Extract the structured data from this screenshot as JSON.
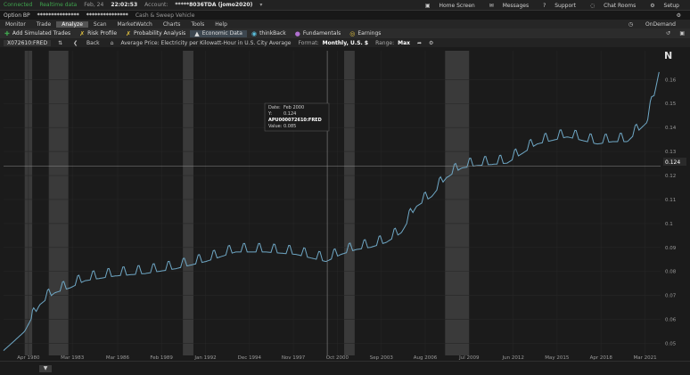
{
  "status": {
    "connected": "Connected",
    "realtime": "Realtime data",
    "date": "Feb, 24",
    "time": "22:02:53",
    "account_label": "Account:",
    "account_value": "*****8036TDA (jomo2020)",
    "right_items": [
      {
        "label": "Home Screen",
        "icon": "home-icon"
      },
      {
        "label": "Messages",
        "icon": "mail-icon"
      },
      {
        "label": "Support",
        "icon": "help-icon"
      },
      {
        "label": "Chat Rooms",
        "icon": "chat-icon"
      },
      {
        "label": "Setup",
        "icon": "gear-icon"
      }
    ]
  },
  "option_bar": {
    "label": "Option BP",
    "masked": "***************",
    "masked2": "***************",
    "vehicle": "Cash & Sweep Vehicle"
  },
  "nav_tabs": [
    "Monitor",
    "Trade",
    "Analyze",
    "Scan",
    "MarketWatch",
    "Charts",
    "Tools",
    "Help"
  ],
  "active_nav": "Analyze",
  "on_demand": "OnDemand",
  "sub_tabs": [
    {
      "label": "Add Simulated Trades",
      "icon": "plus-icon"
    },
    {
      "label": "Risk Profile",
      "icon": "risk-icon"
    },
    {
      "label": "Probability Analysis",
      "icon": "probability-icon"
    },
    {
      "label": "Economic Data",
      "icon": "bank-icon"
    },
    {
      "label": "thinkBack",
      "icon": "thinkback-icon"
    },
    {
      "label": "Fundamentals",
      "icon": "fundamentals-icon"
    },
    {
      "label": "Earnings",
      "icon": "bulb-icon"
    }
  ],
  "active_sub": "Economic Data",
  "toolbar": {
    "symbol": "X072610:FRED",
    "back": "Back",
    "title": "Average Price: Electricity per Kilowatt-Hour in U.S. City Average",
    "format_label": "Format:",
    "format_value": "Monthly, U.S. $",
    "range_label": "Range:",
    "range_value": "Max"
  },
  "tooltip": {
    "date_label": "Date:",
    "date_value": "Feb 2000",
    "y_label": "Y:",
    "y_value": "0.124",
    "series": "APU000072610:FRED",
    "value_label": "Value:",
    "value_value": "0.085"
  },
  "colors": {
    "line": "#6fa8c6",
    "recession": "#3a3a3a",
    "background": "#1b1b1b",
    "grid": "#262626"
  },
  "chart_data": {
    "type": "line",
    "series": [
      {
        "name": "APU000072610:FRED",
        "x": [
          1978.6,
          1980.0,
          1981.0,
          1982.0,
          1983.0,
          1984.0,
          1986.0,
          1988.0,
          1990.0,
          1992.0,
          1994.0,
          1996.0,
          1998.0,
          2000.0,
          2001.0,
          2002.0,
          2003.0,
          2004.0,
          2005.0,
          2006.0,
          2007.0,
          2008.0,
          2009.0,
          2010.0,
          2012.0,
          2014.0,
          2016.0,
          2018.0,
          2019.0,
          2020.0,
          2020.8,
          2021.3,
          2021.8,
          2022.1
        ],
        "y": [
          0.047,
          0.055,
          0.067,
          0.072,
          0.074,
          0.077,
          0.079,
          0.08,
          0.082,
          0.085,
          0.089,
          0.089,
          0.088,
          0.085,
          0.088,
          0.09,
          0.091,
          0.093,
          0.097,
          0.108,
          0.112,
          0.12,
          0.124,
          0.125,
          0.126,
          0.134,
          0.137,
          0.134,
          0.135,
          0.135,
          0.14,
          0.143,
          0.155,
          0.164
        ]
      }
    ],
    "seasonal_amplitude": 0.0035,
    "recessions": [
      [
        1980.0,
        1980.5
      ],
      [
        1981.6,
        1982.9
      ],
      [
        1990.5,
        1991.2
      ],
      [
        2001.2,
        2001.9
      ],
      [
        2007.9,
        2009.5
      ]
    ],
    "x_ticks": [
      "Apr 1980",
      "Mar 1983",
      "Mar 1986",
      "Feb 1989",
      "Jan 1992",
      "Dec 1994",
      "Nov 1997",
      "Oct 2000",
      "Sep 2003",
      "Aug 2006",
      "Jul 2009",
      "Jun 2012",
      "May 2015",
      "Apr 2018",
      "Mar 2021"
    ],
    "x_tick_values": [
      1980.25,
      1983.17,
      1986.17,
      1989.08,
      1992.0,
      1994.92,
      1997.83,
      2000.75,
      2003.67,
      2006.58,
      2009.5,
      2012.42,
      2015.33,
      2018.25,
      2021.17
    ],
    "y_ticks": [
      "0.05",
      "0.06",
      "0.07",
      "0.08",
      "0.09",
      "0.1",
      "0.11",
      "0.12",
      "0.13",
      "0.14",
      "0.15",
      "0.16"
    ],
    "y_tick_values": [
      0.05,
      0.06,
      0.07,
      0.08,
      0.09,
      0.1,
      0.11,
      0.12,
      0.13,
      0.14,
      0.15,
      0.16
    ],
    "xlim": [
      1978.6,
      2022.2
    ],
    "ylim": [
      0.045,
      0.172
    ],
    "crosshair": {
      "x": 2000.08,
      "y": 0.124
    },
    "grid": true
  }
}
